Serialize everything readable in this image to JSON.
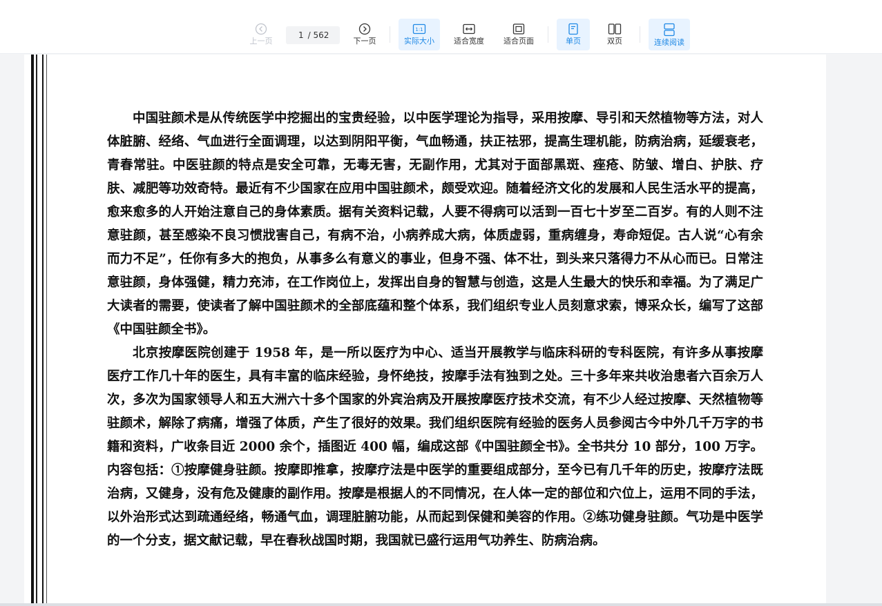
{
  "toolbar": {
    "prev_label": "上一页",
    "page_current": "1",
    "page_total": "/ 562",
    "next_label": "下一页",
    "actual_size_label": "实际大小",
    "fit_width_label": "适合宽度",
    "fit_page_label": "适合页面",
    "single_page_label": "单页",
    "double_page_label": "双页",
    "continuous_label": "连续阅读",
    "actual_size_badge": "1:1"
  },
  "colors": {
    "accent": "#1e88e5",
    "active_bg": "#e8f3ff",
    "disabled": "#c0c4cc"
  },
  "document": {
    "paragraphs": [
      "中国驻颜术是从传统医学中挖掘出的宝贵经验，以中医学理论为指导，采用按摩、导引和天然植物等方法，对人体脏腑、经络、气血进行全面调理，以达到阴阳平衡，气血畅通，扶正祛邪，提高生理机能，防病治病，延缓衰老，青春常驻。中医驻颜的特点是安全可靠，无毒无害，无副作用，尤其对于面部黑斑、痤疮、防皱、增白、护肤、疗肤、减肥等功效奇特。最近有不少国家在应用中国驻颜术，颇受欢迎。随着经济文化的发展和人民生活水平的提高，愈来愈多的人开始注意自己的身体素质。据有关资料记载，人要不得病可以活到一百七十岁至二百岁。有的人则不注意驻颜，甚至感染不良习惯戕害自己，有病不治，小病养成大病，体质虚弱，重病缠身，寿命短促。古人说“心有余而力不足”，任你有多大的抱负，从事多么有意义的事业，但身不强、体不壮，到头来只落得力不从心而已。日常注意驻颜，身体强健，精力充沛，在工作岗位上，发挥出自身的智慧与创造，这是人生最大的快乐和幸福。为了满足广大读者的需要，使读者了解中国驻颜术的全部底蕴和整个体系，我们组织专业人员刻意求索，博采众长，编写了这部《中国驻颜全书》。",
      "北京按摩医院创建于 1958 年，是一所以医疗为中心、适当开展教学与临床科研的专科医院，有许多从事按摩医疗工作几十年的医生，具有丰富的临床经验，身怀绝技，按摩手法有独到之处。三十多年来共收治患者六百余万人次，多次为国家领导人和五大洲六十多个国家的外宾治病及开展按摩医疗技术交流，有不少人经过按摩、天然植物等驻颜术，解除了病痛，增强了体质，产生了很好的效果。我们组织医院有经验的医务人员参阅古今中外几千万字的书籍和资料，广收条目近 2000 余个，插图近 400 幅，编成这部《中国驻颜全书》。全书共分 10 部分，100 万字。内容包括：①按摩健身驻颜。按摩即推拿，按摩疗法是中医学的重要组成部分，至今已有几千年的历史，按摩疗法既治病，又健身，没有危及健康的副作用。按摩是根据人的不同情况，在人体一定的部位和穴位上，运用不同的手法，以外治形式达到疏通经络，畅通气血，调理脏腑功能，从而起到保健和美容的作用。②练功健身驻颜。气功是中医学的一个分支，据文献记载，早在春秋战国时期，我国就已盛行运用气功养生、防病治病。"
    ]
  }
}
